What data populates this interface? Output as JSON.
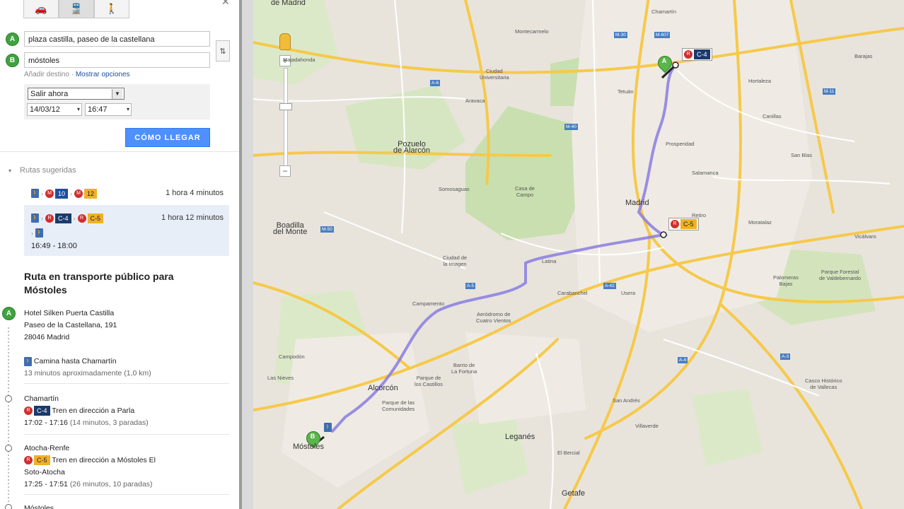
{
  "panel": {
    "modes": [
      "car",
      "transit",
      "walk"
    ],
    "origin_marker": "A",
    "dest_marker": "B",
    "origin_value": "plaza castilla, paseo de la castellana",
    "dest_value": "móstoles",
    "add_destination": "Añadir destino",
    "sep": " · ",
    "show_options": "Mostrar opciones",
    "depart_option": "Salir ahora",
    "date": "14/03/12",
    "time": "16:47",
    "go_button": "CÓMO LLEGAR",
    "suggested_title": "Rutas sugeridas",
    "routes": [
      {
        "badge1": "10",
        "badge2": "12",
        "duration": "1 hora 4 minutos"
      },
      {
        "badge1": "C-4",
        "badge2": "C-5",
        "duration": "1 hora 12 minutos",
        "times": "16:49 - 18:00"
      }
    ],
    "section_title": "Ruta en transporte público para Móstoles",
    "start": {
      "name": "Hotel Silken Puerta Castilla",
      "street": "Paseo de la Castellana, 191",
      "city": "28046 Madrid"
    },
    "walk_step": {
      "text": "Camina hasta Chamartín",
      "detail": "13 minutos aproximadamente (1,0 km)"
    },
    "stops": [
      {
        "name": "Chamartín",
        "line": "C-4",
        "direction": "Tren en dirección a Parla",
        "times": "17:02 - 17:16",
        "detail": "(14 minutos, 3 paradas)"
      },
      {
        "name": "Atocha-Renfe",
        "line": "C-5",
        "direction": "Tren en dirección a Móstoles El",
        "direction2": "Soto-Atocha",
        "times": "17:25 - 17:51",
        "detail": "(26 minutos, 10 paradas)"
      }
    ],
    "last_stop": "Móstoles"
  },
  "map": {
    "zoom_in": "+",
    "zoom_out": "−",
    "marker_a": "A",
    "marker_b": "B",
    "train_tag_1": "C-4",
    "train_tag_2": "C-5",
    "labels": {
      "madrid": "Madrid",
      "de_madrid": "de Madrid",
      "pozuelo": "Pozuelo\nde Alarcón",
      "boadilla": "Boadilla\ndel Monte",
      "alcorcon": "Alcorcón",
      "leganes": "Leganés",
      "mostoles": "Móstoles",
      "getafe": "Getafe",
      "casa_campo": "Casa de\nCampo",
      "valdebernardo": "Parque Forestal\nde Valdebernardo",
      "vallecas": "Casco Histórico\nde Vallecas",
      "majadahonda": "Majadahonda",
      "aravaca": "Aravaca",
      "somosaguas": "Somosaguas",
      "prosperidad": "Prosperidad",
      "chamartin": "Chamartín",
      "carabanchel": "Carabanchel",
      "usera": "Usera",
      "moratalaz": "Moratalaz",
      "vicalvaro": "Vicálvaro",
      "san_blas": "San Blas",
      "ciudad_imagen": "Ciudad de\nla Imagen",
      "campamento": "Campamento",
      "latina": "Latina",
      "parque_comunidades": "Parque de las\nComunidades",
      "parque_castillos": "Parque de\nlos Castillos",
      "la_fortuna": "Barrio de\nLa Fortuna",
      "cuatro_vientos": "Aeródromo de\nCuatro Vientos",
      "campodon": "Campodón",
      "las_nieves": "Las Nieves",
      "el_bercial": "El Bercial",
      "san_andres": "San Andrés",
      "villaverde": "Villaverde",
      "ciudad_universitaria": "Ciudad\nUniversitaria",
      "montecarmelo": "Montecarmelo",
      "tetuan": "Tetuán",
      "hortaleza": "Hortaleza",
      "barajas": "Barajas",
      "canillas": "Canillas",
      "retiro": "Retiro",
      "salamanca": "Salamanca",
      "palomeras": "Palomeras\nBajas"
    },
    "road_tags": [
      "M-30",
      "M-40",
      "M-50",
      "A-5",
      "A-6",
      "A-42",
      "A-4",
      "A-3",
      "M-607",
      "M-11"
    ]
  }
}
